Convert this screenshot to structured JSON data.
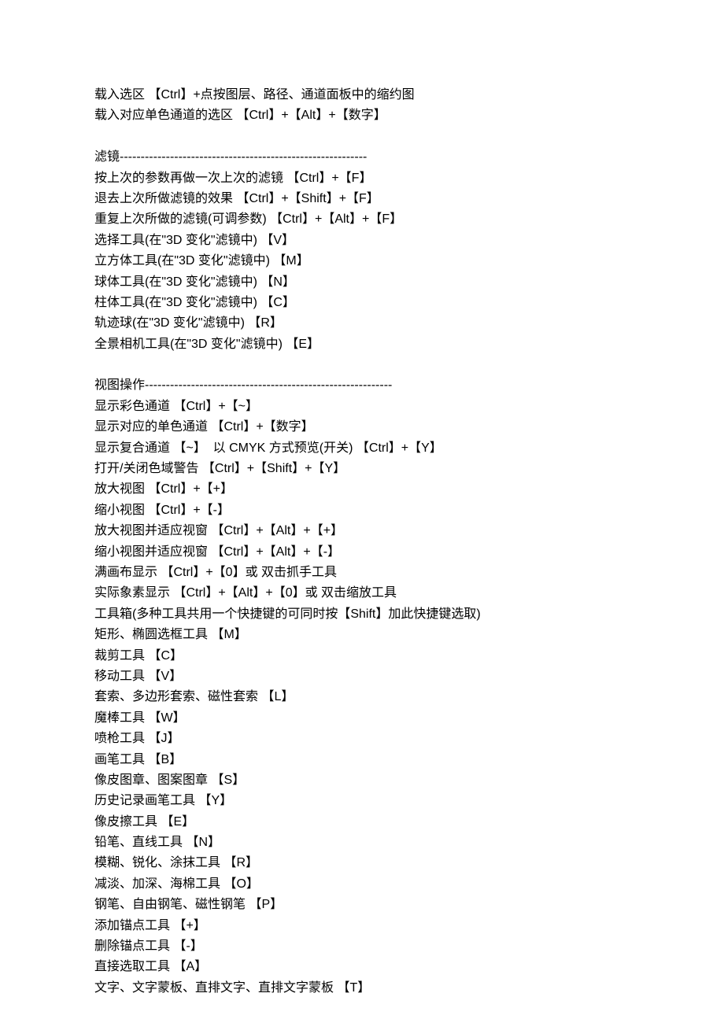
{
  "lines": [
    "载入选区 【Ctrl】+点按图层、路径、通道面板中的缩约图",
    "载入对应单色通道的选区 【Ctrl】+【Alt】+【数字】",
    "",
    "滤镜-----------------------------------------------------------",
    "按上次的参数再做一次上次的滤镜 【Ctrl】+【F】",
    "退去上次所做滤镜的效果 【Ctrl】+【Shift】+【F】",
    "重复上次所做的滤镜(可调参数) 【Ctrl】+【Alt】+【F】",
    "选择工具(在\"3D 变化\"滤镜中) 【V】",
    "立方体工具(在\"3D 变化\"滤镜中) 【M】",
    "球体工具(在\"3D 变化\"滤镜中) 【N】",
    "柱体工具(在\"3D 变化\"滤镜中) 【C】",
    "轨迹球(在\"3D 变化\"滤镜中) 【R】",
    "全景相机工具(在\"3D 变化\"滤镜中) 【E】",
    "",
    "视图操作-----------------------------------------------------------",
    "显示彩色通道 【Ctrl】+【~】",
    "显示对应的单色通道 【Ctrl】+【数字】",
    "显示复合通道 【~】  以 CMYK 方式预览(开关) 【Ctrl】+【Y】",
    "打开/关闭色域警告 【Ctrl】+【Shift】+【Y】",
    "放大视图 【Ctrl】+【+】",
    "缩小视图 【Ctrl】+【-】",
    "放大视图并适应视窗 【Ctrl】+【Alt】+【+】",
    "缩小视图并适应视窗 【Ctrl】+【Alt】+【-】",
    "满画布显示 【Ctrl】+【0】或 双击抓手工具",
    "实际象素显示 【Ctrl】+【Alt】+【0】或 双击缩放工具",
    "工具箱(多种工具共用一个快捷键的可同时按【Shift】加此快捷键选取)",
    "矩形、椭圆选框工具 【M】",
    "裁剪工具 【C】",
    "移动工具 【V】",
    "套索、多边形套索、磁性套索 【L】",
    "魔棒工具 【W】",
    "喷枪工具 【J】",
    "画笔工具 【B】",
    "像皮图章、图案图章 【S】",
    "历史记录画笔工具 【Y】",
    "像皮擦工具 【E】",
    "铅笔、直线工具 【N】",
    "模糊、锐化、涂抹工具 【R】",
    "减淡、加深、海棉工具 【O】",
    "钢笔、自由钢笔、磁性钢笔 【P】",
    "添加锚点工具 【+】",
    "删除锚点工具 【-】",
    "直接选取工具 【A】",
    "文字、文字蒙板、直排文字、直排文字蒙板 【T】"
  ]
}
